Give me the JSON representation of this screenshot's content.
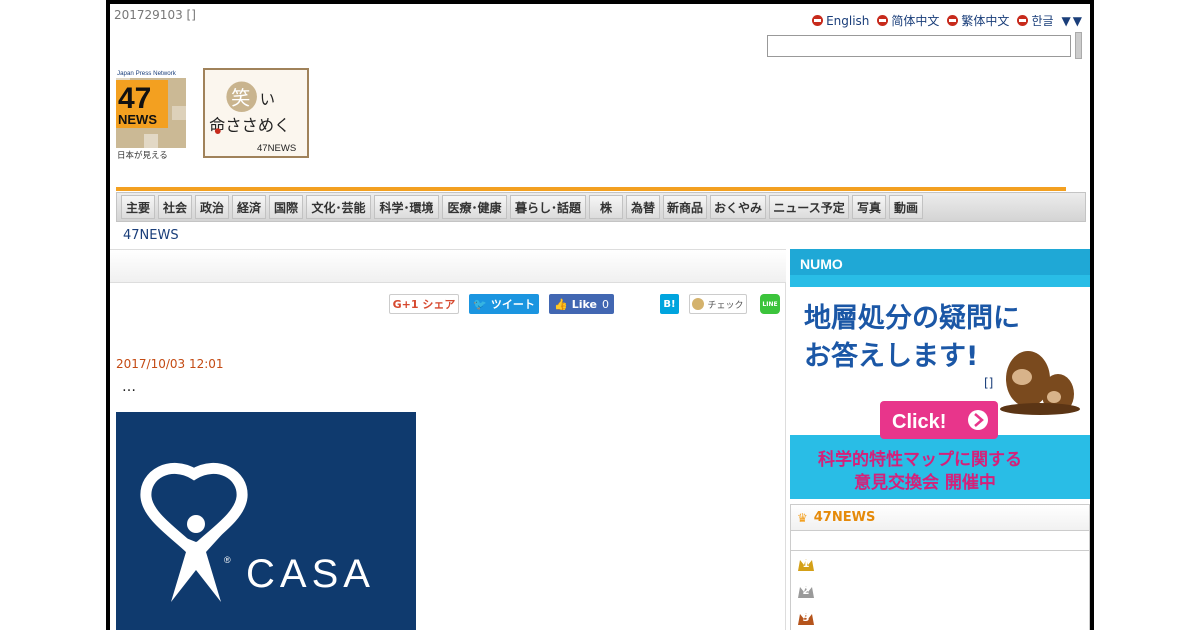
{
  "header": {
    "page_id": "201729103 []",
    "languages": [
      {
        "label": "English"
      },
      {
        "label": "简体中文"
      },
      {
        "label": "繁体中文"
      },
      {
        "label": "한글"
      }
    ],
    "lang_toggle": "▼▼",
    "search": {
      "value": "",
      "placeholder": ""
    }
  },
  "logos": {
    "jpn_caption": "Japan Press Network",
    "number": "47",
    "news": "NEWS",
    "tagline": "日本が見える",
    "warai": {
      "kanji": "笑",
      "line1": "い",
      "line2": "命ささめく",
      "brand": "47NEWS"
    }
  },
  "nav": {
    "items": [
      {
        "label": "主要"
      },
      {
        "label": "社会"
      },
      {
        "label": "政治"
      },
      {
        "label": "経済"
      },
      {
        "label": "国際"
      },
      {
        "label": "文化･芸能"
      },
      {
        "label": "科学･環境"
      },
      {
        "label": "医療･健康"
      },
      {
        "label": "暮らし･話題"
      },
      {
        "label": "株"
      },
      {
        "label": "為替"
      },
      {
        "label": "新商品"
      },
      {
        "label": "おくやみ"
      },
      {
        "label": "ニュース予定"
      },
      {
        "label": "写真"
      },
      {
        "label": "動画"
      }
    ]
  },
  "breadcrumb": "47NEWS",
  "share": {
    "gplus": "G+1 シェア",
    "tweet": "ツイート",
    "like": "Like",
    "like_count": "0",
    "hatena": "B!",
    "mixi": "チェック",
    "line": "LINE"
  },
  "article": {
    "date": "2017/10/03 12:01",
    "text": "…",
    "image_brand": "CASA",
    "image_mark": "®"
  },
  "ad": {
    "brand": "NUMO",
    "headline_1": "地層処分の疑問に",
    "headline_2": "お答えします!",
    "cta": "Click!",
    "sub_1": "科学的特性マップに関する",
    "sub_2": "意見交換会 開催中",
    "bracket": "[]"
  },
  "ranking": {
    "title": "47NEWS",
    "ranks": [
      "1",
      "2",
      "3"
    ]
  },
  "colors": {
    "accent_orange": "#f3a020",
    "link_blue": "#1a3e7a",
    "date_red": "#c44b14",
    "ad_cyan": "#1fb3e0",
    "casa_navy": "#0f3a6e"
  }
}
